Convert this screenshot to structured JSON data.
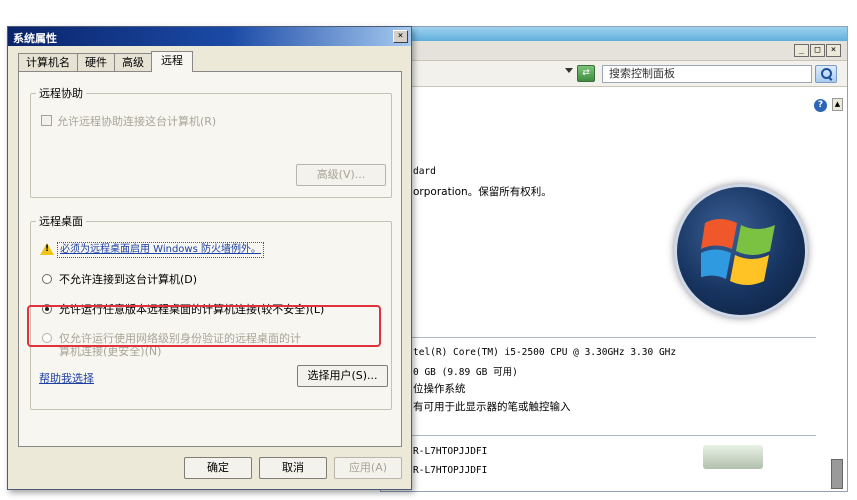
{
  "dialog": {
    "title": "系统属性",
    "close_glyph": "×",
    "tabs": [
      {
        "label": "计算机名",
        "active": false
      },
      {
        "label": "硬件",
        "active": false
      },
      {
        "label": "高级",
        "active": false
      },
      {
        "label": "远程",
        "active": true
      }
    ],
    "remote_assistance": {
      "legend": "远程协助",
      "checkbox_label": "允许远程协助连接这台计算机(R)",
      "checked": false,
      "enabled": false,
      "advanced_button": "高级(V)..."
    },
    "remote_desktop": {
      "legend": "远程桌面",
      "warning_link": "必须为远程桌面启用 Windows 防火墙例外。",
      "options": [
        {
          "label": "不允许连接到这台计算机(D)",
          "checked": false,
          "enabled": true
        },
        {
          "label": "允许运行任意版本远程桌面的计算机连接(较不安全)(L)",
          "checked": true,
          "enabled": true
        },
        {
          "label_line1": "仅允许运行使用网络级别身份验证的远程桌面的计",
          "label_line2": "算机连接(更安全)(N)",
          "checked": false,
          "enabled": false
        }
      ],
      "help_link": "帮助我选择",
      "select_users_button": "选择用户(S)..."
    },
    "buttons": {
      "ok": "确定",
      "cancel": "取消",
      "apply": "应用(A)"
    },
    "highlight_color": "#e0323c"
  },
  "background_window": {
    "caption_buttons": [
      "_",
      "□",
      "×"
    ],
    "search_placeholder": "搜索控制面板",
    "edition_text": "dard",
    "copyright_text": "orporation。保留所有权利。",
    "processor_text": "tel(R) Core(TM) i5-2500 CPU @ 3.30GHz   3.30 GHz",
    "memory_text": "0 GB (9.89 GB 可用)",
    "system_type_text": "位操作系统",
    "pen_touch_text": "有可用于此显示器的笔或触控输入",
    "computer_name_text": "R-L7HTOPJJDFI",
    "full_name_text": "R-L7HTOPJJDFI"
  },
  "colors": {
    "titlebar_start": "#0a246a",
    "dialog_bg": "#ece9d8",
    "link": "#1c3fa3"
  }
}
